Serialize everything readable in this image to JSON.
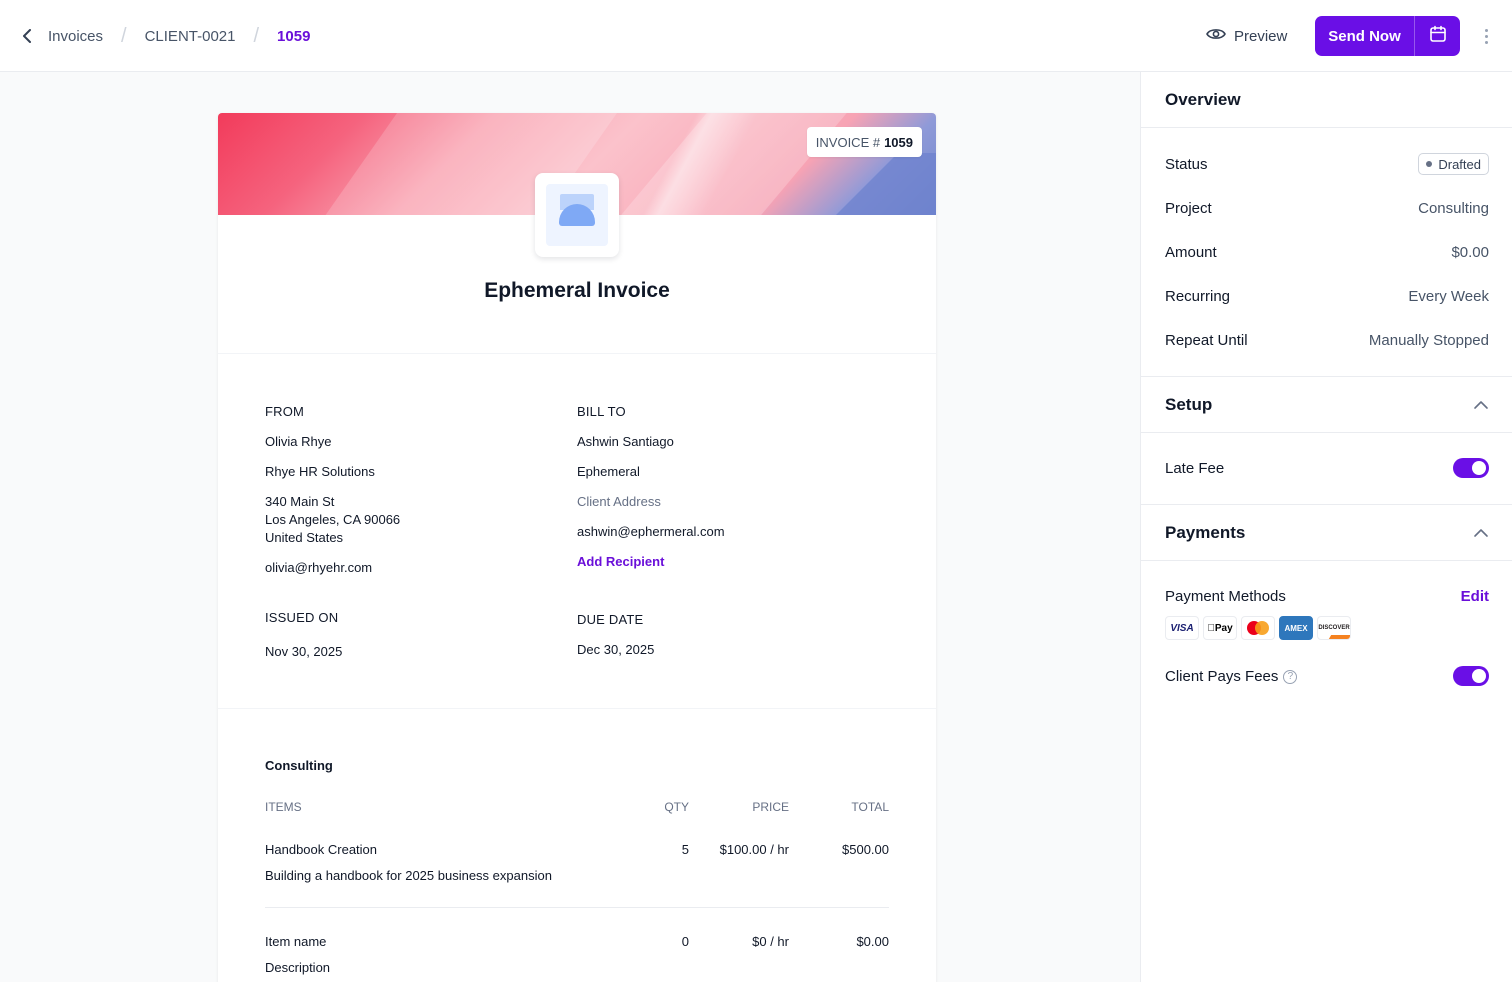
{
  "breadcrumb": {
    "items": [
      "Invoices",
      "CLIENT-0021",
      "1059"
    ]
  },
  "header": {
    "preview_label": "Preview",
    "send_label": "Send Now"
  },
  "invoice": {
    "badge_prefix": "INVOICE #",
    "badge_number": "1059",
    "title": "Ephemeral Invoice",
    "from": {
      "label": "FROM",
      "name": "Olivia Rhye",
      "company": "Rhye HR Solutions",
      "address_line1": "340 Main St",
      "address_line2": "Los Angeles, CA 90066",
      "address_line3": "United States",
      "email": "olivia@rhyehr.com"
    },
    "bill_to": {
      "label": "BILL TO",
      "name": "Ashwin Santiago",
      "company": "Ephemeral",
      "address_placeholder": "Client Address",
      "email": "ashwin@ephermeral.com",
      "add_recipient": "Add Recipient"
    },
    "issued": {
      "label": "ISSUED ON",
      "value": "Nov 30, 2025"
    },
    "due": {
      "label": "DUE DATE",
      "value": "Dec 30, 2025"
    },
    "section_title": "Consulting",
    "columns": [
      "ITEMS",
      "QTY",
      "PRICE",
      "TOTAL"
    ],
    "items": [
      {
        "name": "Handbook Creation",
        "description": "Building a handbook for 2025 business expansion",
        "qty": "5",
        "price": "$100.00 / hr",
        "total": "$500.00"
      },
      {
        "name": "Item name",
        "description": "Description",
        "qty": "0",
        "price": "$0 / hr",
        "total": "$0.00"
      }
    ]
  },
  "overview": {
    "title": "Overview",
    "status_label": "Status",
    "status_value": "Drafted",
    "project_label": "Project",
    "project_value": "Consulting",
    "amount_label": "Amount",
    "amount_value": "$0.00",
    "recurring_label": "Recurring",
    "recurring_value": "Every Week",
    "repeat_label": "Repeat Until",
    "repeat_value": "Manually Stopped"
  },
  "setup": {
    "title": "Setup",
    "late_fee_label": "Late Fee",
    "late_fee_on": true
  },
  "payments": {
    "title": "Payments",
    "methods_label": "Payment Methods",
    "edit_label": "Edit",
    "cards": [
      "VISA",
      "Pay",
      "mastercard",
      "AMEX",
      "DISCOVER"
    ],
    "client_pays_label": "Client Pays Fees",
    "client_pays_on": true
  },
  "colors": {
    "accent": "#6a0fe6",
    "link": "#6a0fd9"
  }
}
